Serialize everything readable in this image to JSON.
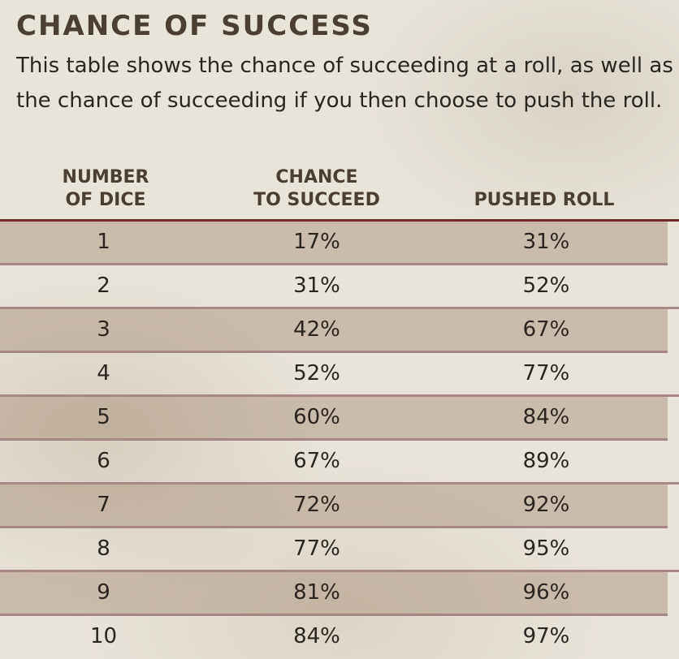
{
  "title": "CHANCE OF SUCCESS",
  "intro": "This table shows the chance of succeeding at a roll, as well as the chance of succeeding if you then choose to push the roll.",
  "headers": {
    "dice": [
      "NUMBER",
      "OF DICE"
    ],
    "chance": [
      "CHANCE",
      "TO SUCCEED"
    ],
    "pushed": [
      "PUSHED ROLL"
    ]
  },
  "rows": [
    {
      "dice": "1",
      "chance": "17%",
      "pushed": "31%"
    },
    {
      "dice": "2",
      "chance": "31%",
      "pushed": "52%"
    },
    {
      "dice": "3",
      "chance": "42%",
      "pushed": "67%"
    },
    {
      "dice": "4",
      "chance": "52%",
      "pushed": "77%"
    },
    {
      "dice": "5",
      "chance": "60%",
      "pushed": "84%"
    },
    {
      "dice": "6",
      "chance": "67%",
      "pushed": "89%"
    },
    {
      "dice": "7",
      "chance": "72%",
      "pushed": "92%"
    },
    {
      "dice": "8",
      "chance": "77%",
      "pushed": "95%"
    },
    {
      "dice": "9",
      "chance": "81%",
      "pushed": "96%"
    },
    {
      "dice": "10",
      "chance": "84%",
      "pushed": "97%"
    }
  ],
  "colors": {
    "heading": "#4a3f30",
    "text": "#2a2520",
    "header_rule": "#6e2a2a",
    "row_rule": "#a88886",
    "shaded_row": "#c9b8a6",
    "paper": "#e9e4da"
  }
}
